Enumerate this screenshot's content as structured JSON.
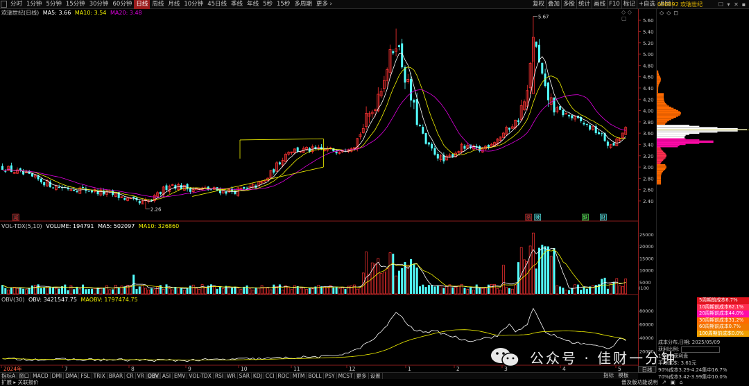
{
  "toolbar": {
    "periods": [
      "分时",
      "1分钟",
      "5分钟",
      "15分钟",
      "30分钟",
      "60分钟",
      "日线",
      "周线",
      "月线",
      "10分钟",
      "45日线",
      "季线",
      "年线",
      "5秒",
      "15秒",
      "多周期",
      "更多 ›"
    ],
    "active_period": "日线",
    "tools": [
      "复权",
      "叠加",
      "多股",
      "统计",
      "画线",
      "F10",
      "标记",
      "+自选",
      "返回"
    ],
    "stock": "000892 欢瑞世纪",
    "window_icons": [
      "☐",
      "▾",
      "✕",
      "▪"
    ]
  },
  "main_legend": {
    "title": "欢瑞世纪(日线)",
    "ma5": "MA5: 3.66",
    "ma10": "MA10: 3.54",
    "ma20": "MA20: 3.48",
    "corner": "◇ ◇ ▢"
  },
  "price_axis": [
    "5.60",
    "5.40",
    "5.20",
    "5.00",
    "4.80",
    "4.60",
    "4.40",
    "4.20",
    "4.00",
    "3.80",
    "3.60",
    "3.40",
    "3.20",
    "3.00",
    "2.80",
    "2.60",
    "2.40"
  ],
  "annotations": {
    "high": "5.67",
    "low": "2.26",
    "marks": [
      "减",
      "杀",
      "赎",
      "跌",
      "财"
    ]
  },
  "volume_legend": {
    "title": "VOL-TDX(5,10)",
    "volume": "VOLUME: 194791",
    "ma5": "MA5: 502097",
    "ma10": "MA10: 326860"
  },
  "volume_axis": [
    "25000",
    "20000",
    "15000",
    "10000",
    "5000",
    "X100"
  ],
  "obv_legend": {
    "title": "OBV(30)",
    "obv": "OBV: 3421547.75",
    "maobv": "MAOBV: 1797474.75"
  },
  "obv_axis": [
    "80000",
    "60000",
    "40000",
    "20000"
  ],
  "x_axis": [
    "2024年",
    "7",
    "8",
    "9",
    "10",
    "11",
    "12",
    "1",
    "2",
    "3",
    "4",
    "5"
  ],
  "side_panel": {
    "buttons": [
      "◇",
      "◇",
      "◻"
    ]
  },
  "chip_legend": [
    {
      "label": "5周期前成本6.7%",
      "color": "#e0141e"
    },
    {
      "label": "10周期前成本62.1%",
      "color": "#ff2e50"
    },
    {
      "label": "20周期前成本44.0%",
      "color": "#ff0aa8"
    },
    {
      "label": "30周期前成本31.2%",
      "color": "#ff6a00"
    },
    {
      "label": "60周期前成本0.7%",
      "color": "#f07800"
    },
    {
      "label": "100周期前成本0.0%",
      "color": "#f0a000"
    }
  ],
  "chip_info": {
    "date": "成本分布,日期: 2025/05/09",
    "profit_label": "获利比例:",
    "profit_ratio": "",
    "profit_note": "1.00%获利盘",
    "avg_cost": "平均成本: 3.61元",
    "c90": "90%成本3.29-4.24集中16.7%",
    "c70": "70%成本3.42-3.99集中10.0%"
  },
  "chip_icons": "⚙ ⊞ ◈ ▣ ▤ ▥ ▦ ▧ ▨",
  "tabs": [
    "指标A",
    "窗口",
    "MACD",
    "DMI",
    "DMA",
    "FSL",
    "TRIX",
    "BRAR",
    "CR",
    "VR",
    "OBV",
    "ASI",
    "EMV",
    "VOL-TDX",
    "RSI",
    "WR",
    "SAR",
    "KDJ",
    "CCI",
    "ROC",
    "MTM",
    "BOLL",
    "PSY",
    "MCST",
    "更多",
    "设置"
  ],
  "active_tab": "OBV",
  "tabs_right": [
    "指标",
    "模板"
  ],
  "day_button": "日线",
  "status_left": "扩展 ▸  关联报价",
  "status_right": [
    "普及版功能说明",
    "↗",
    "▣",
    "⌂"
  ],
  "watermark": "公众号 · 佳财一分钟",
  "colors": {
    "up": "#ff3232",
    "down": "#54ffff",
    "ma5": "#ffffff",
    "ma10": "#f0f000",
    "ma20": "#e000e0",
    "accent_red": "#9b1c1c"
  },
  "chart_data": {
    "type": "candlestick",
    "x_ticks": [
      "2024年",
      "7",
      "8",
      "9",
      "10",
      "11",
      "12",
      "1",
      "2",
      "3",
      "4",
      "5"
    ],
    "price_range": [
      2.26,
      5.67
    ],
    "key_points": [
      {
        "x": "8",
        "price": 2.26,
        "label": "2.26"
      },
      {
        "x": "3",
        "price": 5.67,
        "label": "5.67"
      }
    ],
    "price_path": [
      [
        "2024年",
        3.0
      ],
      [
        "7",
        2.62
      ],
      [
        "8",
        2.45
      ],
      [
        "9",
        2.56
      ],
      [
        "10",
        3.3
      ],
      [
        "11",
        3.28
      ],
      [
        "12",
        5.3
      ],
      [
        "1",
        3.1
      ],
      [
        "2",
        3.7
      ],
      [
        "3",
        5.55
      ],
      [
        "4",
        3.45
      ],
      [
        "5",
        3.66
      ]
    ],
    "volume_range": [
      0,
      27000
    ],
    "obv_range": [
      0,
      90000
    ]
  }
}
